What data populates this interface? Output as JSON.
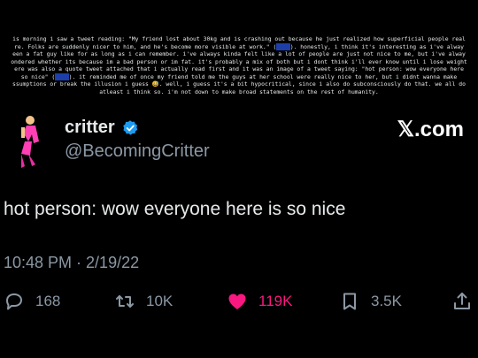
{
  "caption": {
    "lines": [
      {
        "before": "is morning i saw a tweet reading: \"My friend lost about 30kg and is crashing out because he just realized how superficial people real",
        "link": "",
        "after": ""
      },
      {
        "before": "re. Folks are suddenly nicer to him, and he's become more visible at work.\" (",
        "link": "link",
        "after": "). honestly, i think it's interesting as i've alway"
      },
      {
        "before": "een a fat guy like for as long as i can remember. i've always kinda felt like a lot of people are just not nice to me, but i've alway",
        "link": "",
        "after": ""
      },
      {
        "before": "ondered whether its because im a bad person or im fat. it's probably a mix of both but i dont think i'll ever know until i lose weight",
        "link": "",
        "after": ""
      },
      {
        "before": "ere was also a quote tweet attached that i actually read first and it was an image of a tweet saying: \"hot person: wow everyone here",
        "link": "",
        "after": ""
      },
      {
        "before": "so nice\" (",
        "link": "link",
        "after": "). it reminded me of once my friend told me the guys at her school were really nice to her, but i didnt wanna make"
      },
      {
        "before": "ssumptions or break the illusion i guess 😅. well, i guess it's a bit hypocritical, since i also do subconsciously do that. we all do",
        "link": "",
        "after": ""
      },
      {
        "before": "atleast i think so. i'm not down to make broad statements on the rest of humanity.",
        "link": "",
        "after": ""
      }
    ]
  },
  "tweet": {
    "display_name": "critter",
    "handle": "@BecomingCritter",
    "brand": "𝕏.com",
    "text": "hot person: wow everyone here is so nice",
    "time": "10:48 PM · 2/19/22",
    "replies": "168",
    "retweets": "10K",
    "likes": "119K",
    "bookmarks": "3.5K"
  },
  "colors": {
    "background": "#000000",
    "text": "#e7e9ea",
    "muted": "#8b98a5",
    "like": "#f91880",
    "verified": "#1d9bf0"
  }
}
